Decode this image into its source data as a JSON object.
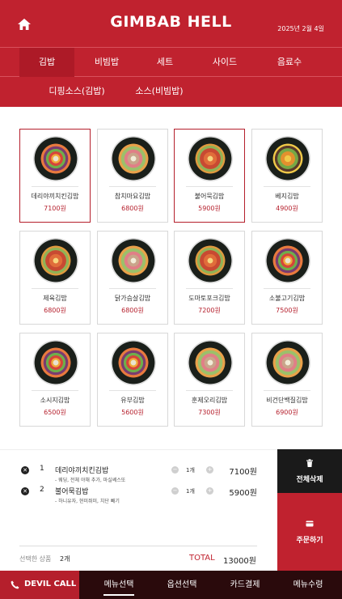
{
  "header": {
    "brand": "GIMBAB HELL",
    "date": "2025년 2월 4일",
    "home_icon": "home-icon"
  },
  "categories_row1": [
    "김밥",
    "비빔밥",
    "세트",
    "사이드",
    "음료수"
  ],
  "categories_row2": [
    "디핑소스(김밥)",
    "소스(비빔밥)"
  ],
  "active_category": "김밥",
  "menu": [
    {
      "name": "데리야끼치킨김밥",
      "price": "7100원",
      "selected": true
    },
    {
      "name": "참치마요김밥",
      "price": "6800원",
      "selected": false
    },
    {
      "name": "불어묵김밥",
      "price": "5900원",
      "selected": true
    },
    {
      "name": "베지김밥",
      "price": "4900원",
      "selected": false
    },
    {
      "name": "제육김밥",
      "price": "6800원",
      "selected": false
    },
    {
      "name": "닭가슴살김밥",
      "price": "6800원",
      "selected": false
    },
    {
      "name": "도마토포크김밥",
      "price": "7200원",
      "selected": false
    },
    {
      "name": "소불고기김밥",
      "price": "7500원",
      "selected": false
    },
    {
      "name": "소시지김밥",
      "price": "6500원",
      "selected": false
    },
    {
      "name": "유부김밥",
      "price": "5600원",
      "selected": false
    },
    {
      "name": "훈제오리김밥",
      "price": "7300원",
      "selected": false
    },
    {
      "name": "비건단백질김밥",
      "price": "6900원",
      "selected": false
    }
  ],
  "order": {
    "items": [
      {
        "index": "1",
        "name": "데리야끼치킨김밥",
        "options": "- 웨딩, 전체 야채 추가, 마실쎄스또",
        "qty": "1개",
        "price": "7100원"
      },
      {
        "index": "2",
        "name": "불어묵김밥",
        "options": "- 하니유자, 현미쥐미, 치단 빼기",
        "qty": "1개",
        "price": "5900원"
      }
    ],
    "selected_label": "선택한 상품",
    "selected_count": "2개",
    "total_label": "TOTAL",
    "total_value": "13000원"
  },
  "actions": {
    "clear_label": "전체삭제",
    "order_label": "주문하기"
  },
  "bottom_nav": {
    "call_label": "DEVIL CALL",
    "items": [
      "메뉴선택",
      "옵션선택",
      "카드결제",
      "메뉴수령"
    ],
    "active": "메뉴선택"
  },
  "colors": {
    "brand_red": "#c0222f",
    "dark": "#1a1a1a",
    "bottom_bg": "#2a0a0c"
  }
}
